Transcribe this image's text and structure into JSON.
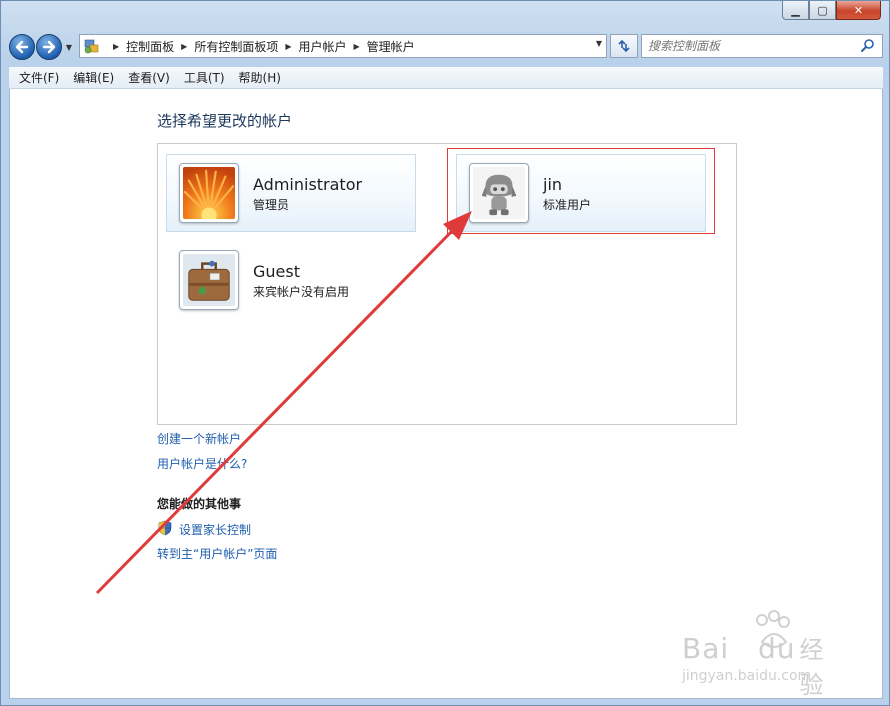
{
  "window": {
    "caption_buttons": {
      "minimize": "▁",
      "maximize": "▢",
      "close": "✕"
    }
  },
  "nav": {
    "back_icon": "back-arrow-icon",
    "forward_icon": "forward-arrow-icon",
    "breadcrumbs": [
      "控制面板",
      "所有控制面板项",
      "用户帐户",
      "管理帐户"
    ],
    "search_placeholder": "搜索控制面板"
  },
  "menu": [
    "文件(F)",
    "编辑(E)",
    "查看(V)",
    "工具(T)",
    "帮助(H)"
  ],
  "main": {
    "title": "选择希望更改的帐户",
    "accounts": [
      {
        "name": "Administrator",
        "role": "管理员",
        "avatar": "flower-avatar"
      },
      {
        "name": "jin",
        "role": "标准用户",
        "avatar": "robot-avatar"
      },
      {
        "name": "Guest",
        "role": "来宾帐户没有启用",
        "avatar": "suitcase-avatar"
      }
    ],
    "links": [
      "创建一个新帐户",
      "用户帐户是什么?"
    ],
    "other_heading": "您能做的其他事",
    "other_links": [
      "设置家长控制",
      "转到主“用户帐户”页面"
    ]
  },
  "watermark": {
    "brand": "Bai",
    "brand2": "du",
    "cn": "经验",
    "url": "jingyan.baidu.com"
  },
  "colors": {
    "link": "#1f5fae",
    "title": "#1e395b",
    "annotation": "#e03b3b"
  }
}
